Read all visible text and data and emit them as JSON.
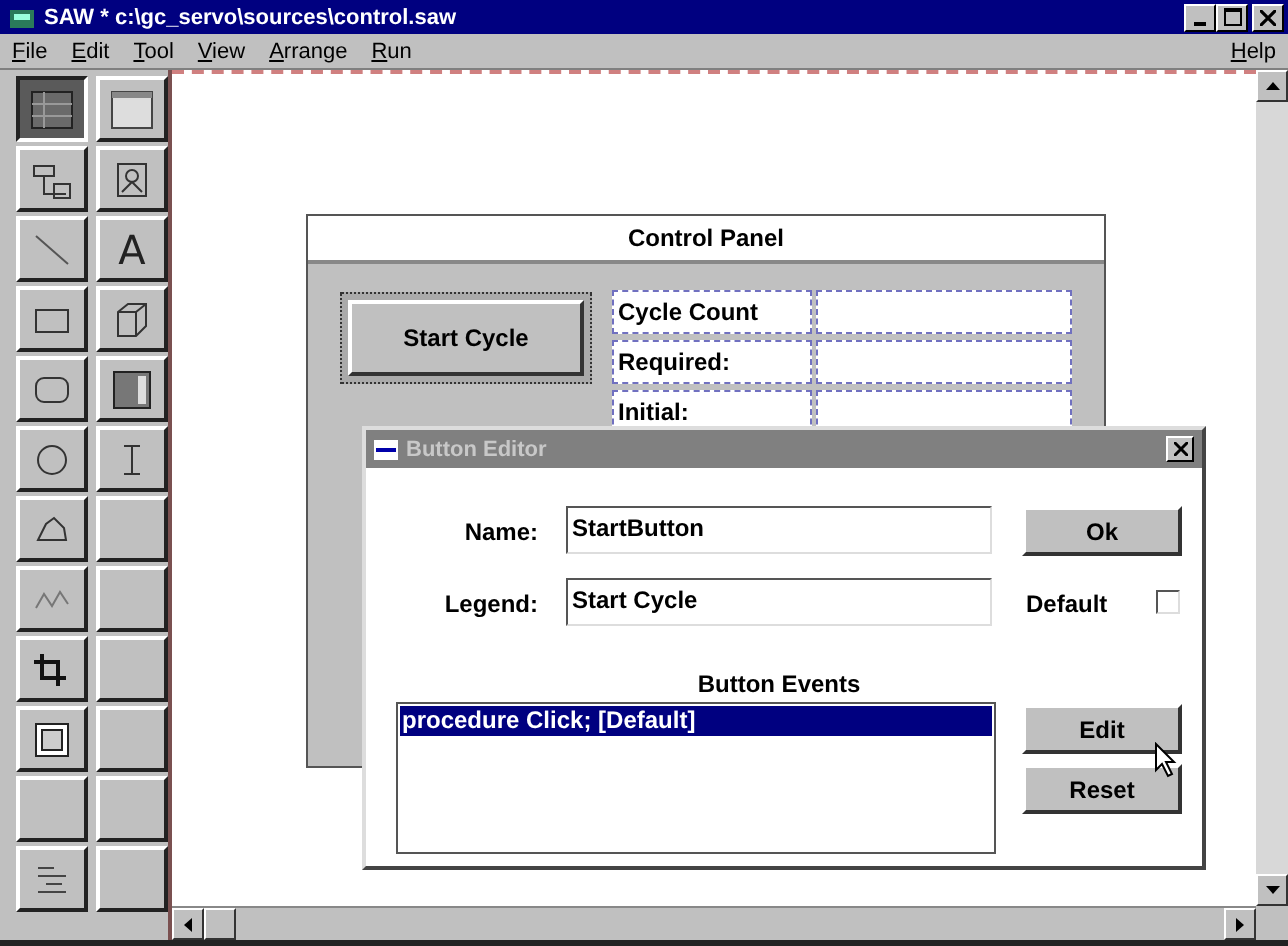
{
  "window": {
    "title": "SAW * c:\\gc_servo\\sources\\control.saw",
    "active": true
  },
  "menu": [
    "File",
    "Edit",
    "Tool",
    "View",
    "Arrange",
    "Run"
  ],
  "help_menu": "Help",
  "toolbox": [
    {
      "kind": "pointer",
      "selected": true
    },
    {
      "kind": "frame",
      "selected": false
    },
    {
      "kind": "group",
      "selected": false
    },
    {
      "kind": "image",
      "selected": false
    },
    {
      "kind": "line",
      "selected": false
    },
    {
      "kind": "text",
      "glyph": "A",
      "selected": false
    },
    {
      "kind": "rect",
      "selected": false
    },
    {
      "kind": "cube",
      "selected": false
    },
    {
      "kind": "roundrect",
      "selected": false
    },
    {
      "kind": "panel",
      "selected": false
    },
    {
      "kind": "ellipse",
      "selected": false
    },
    {
      "kind": "ibeam",
      "selected": false
    },
    {
      "kind": "polygon",
      "selected": false
    },
    {
      "kind": "empty",
      "selected": false
    },
    {
      "kind": "wave",
      "selected": false
    },
    {
      "kind": "empty",
      "selected": false
    },
    {
      "kind": "crop",
      "selected": false
    },
    {
      "kind": "empty",
      "selected": false
    },
    {
      "kind": "button",
      "selected": false
    },
    {
      "kind": "empty",
      "selected": false
    },
    {
      "kind": "empty",
      "selected": false
    },
    {
      "kind": "empty",
      "selected": false
    },
    {
      "kind": "list",
      "selected": false
    },
    {
      "kind": "empty",
      "selected": false
    }
  ],
  "control_panel": {
    "title": "Control Panel",
    "button": "Start Cycle",
    "fields": [
      {
        "label": "Cycle Count"
      },
      {
        "label": "Required:"
      },
      {
        "label": "Initial:"
      }
    ]
  },
  "button_editor": {
    "title": "Button Editor",
    "active": false,
    "name_label": "Name:",
    "name_value": "StartButton",
    "legend_label": "Legend:",
    "legend_value": "Start Cycle",
    "default_label": "Default",
    "default_checked": false,
    "events_label": "Button Events",
    "events": [
      {
        "text": "procedure Click; [Default]",
        "selected": true
      }
    ],
    "buttons": [
      "Ok",
      "Edit",
      "Reset"
    ]
  }
}
